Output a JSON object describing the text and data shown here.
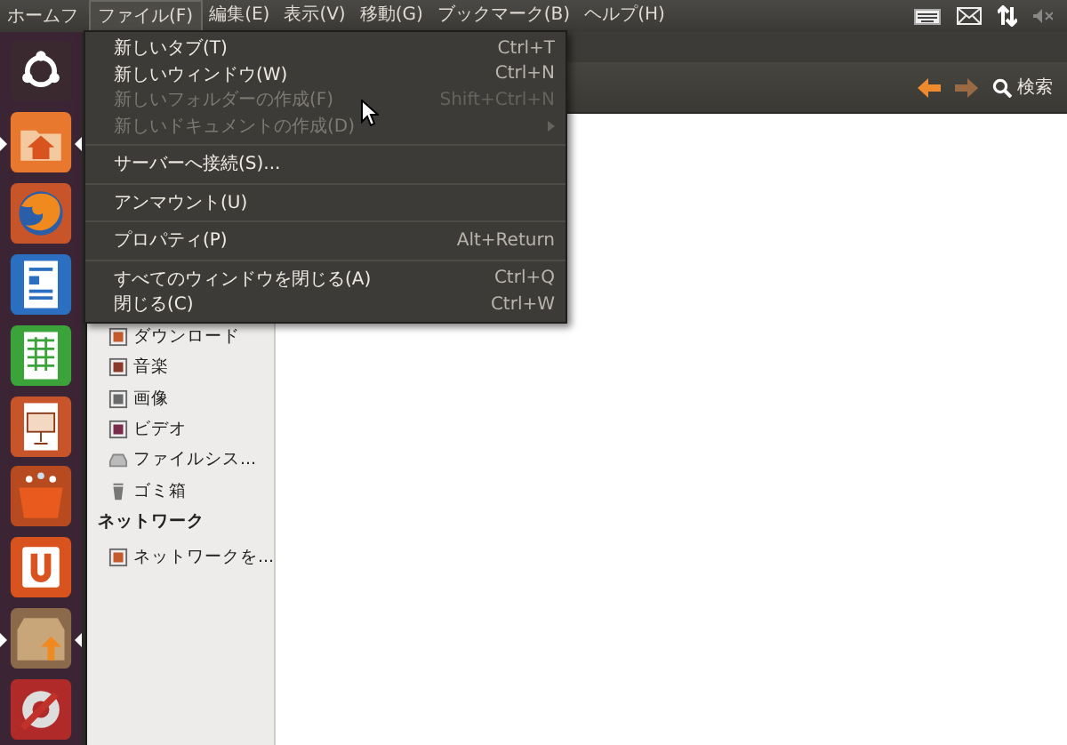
{
  "top_panel": {
    "app_title": "ホームフ",
    "menus": [
      {
        "label": "ファイル(F)",
        "selected": true
      },
      {
        "label": "編集(E)",
        "selected": false
      },
      {
        "label": "表示(V)",
        "selected": false
      },
      {
        "label": "移動(G)",
        "selected": false
      },
      {
        "label": "ブックマーク(B)",
        "selected": false
      },
      {
        "label": "ヘルプ(H)",
        "selected": false
      }
    ]
  },
  "launcher": [
    {
      "kind": "dash",
      "running": false
    },
    {
      "kind": "home",
      "running": true
    },
    {
      "kind": "browser",
      "running": false
    },
    {
      "kind": "writer",
      "running": false
    },
    {
      "kind": "calc",
      "running": false
    },
    {
      "kind": "impress",
      "running": false
    },
    {
      "kind": "software",
      "running": false
    },
    {
      "kind": "one",
      "running": false
    },
    {
      "kind": "update",
      "running": true
    },
    {
      "kind": "settings",
      "running": false
    }
  ],
  "toolbar": {
    "search_label": "検索"
  },
  "sidebar": {
    "items": [
      {
        "label": "ダウンロード",
        "kind": "download"
      },
      {
        "label": "音楽",
        "kind": "music"
      },
      {
        "label": "画像",
        "kind": "pictures"
      },
      {
        "label": "ビデオ",
        "kind": "video"
      },
      {
        "label": "ファイルシス...",
        "kind": "drive"
      },
      {
        "label": "ゴミ箱",
        "kind": "trash"
      }
    ],
    "network_header": "ネットワーク",
    "network_items": [
      {
        "label": "ネットワークを...",
        "kind": "network"
      }
    ]
  },
  "file_menu": {
    "groups": [
      [
        {
          "label": "新しいタブ(T)",
          "shortcut": "Ctrl+T",
          "disabled": false,
          "kind": "item"
        },
        {
          "label": "新しいウィンドウ(W)",
          "shortcut": "Ctrl+N",
          "disabled": false,
          "kind": "item"
        },
        {
          "label": "新しいフォルダーの作成(F)",
          "shortcut": "Shift+Ctrl+N",
          "disabled": true,
          "kind": "item"
        },
        {
          "label": "新しいドキュメントの作成(D)",
          "disabled": true,
          "kind": "submenu"
        }
      ],
      [
        {
          "label": "サーバーへ接続(S)...",
          "disabled": false,
          "kind": "item"
        }
      ],
      [
        {
          "label": "アンマウント(U)",
          "disabled": false,
          "kind": "item"
        }
      ],
      [
        {
          "label": "プロパティ(P)",
          "shortcut": "Alt+Return",
          "disabled": false,
          "kind": "item"
        }
      ],
      [
        {
          "label": "すべてのウィンドウを閉じる(A)",
          "shortcut": "Ctrl+Q",
          "disabled": false,
          "kind": "item"
        },
        {
          "label": "閉じる(C)",
          "shortcut": "Ctrl+W",
          "disabled": false,
          "kind": "item"
        }
      ]
    ]
  }
}
